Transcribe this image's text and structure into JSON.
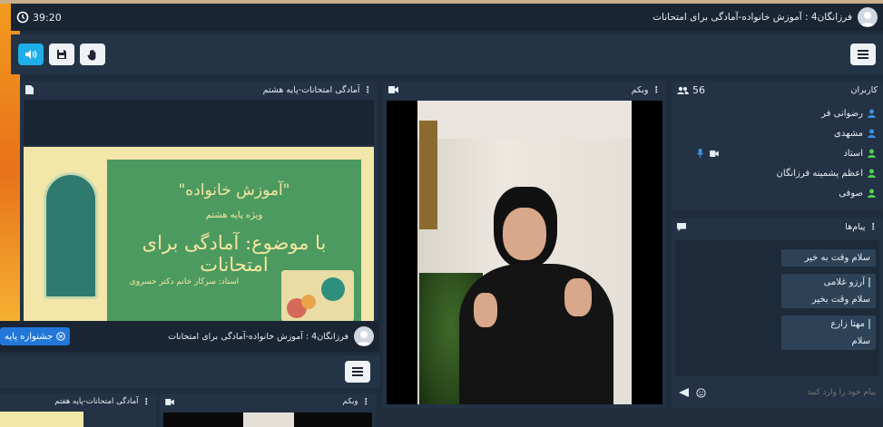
{
  "header": {
    "timer": "39:20",
    "title": "فرزانگان4 : آموزش خانواده-آمادگی برای امتحانات"
  },
  "toolbar": {
    "buttons": [
      "speaker-icon",
      "save-icon",
      "hand-icon"
    ],
    "menu": "menu-icon"
  },
  "presentation": {
    "title": "آمادگی امتحانات-پایه هشتم",
    "slide": {
      "line1": "\"آموزش خانواده\"",
      "line2": "ویژه پایه هشتم",
      "line3": "با موضوع: آمادگی برای امتحانات",
      "line4": "استاد: سرکار خانم دکتر خسروی"
    }
  },
  "webcam": {
    "title": "وبکم"
  },
  "users": {
    "title": "کاربران",
    "count": "56",
    "list": [
      {
        "name": "رضوانی فر",
        "color": "#3b8fe0"
      },
      {
        "name": "مشهدی",
        "color": "#3b8fe0"
      },
      {
        "name": "استاد",
        "color": "#4cd34c"
      },
      {
        "name": "اعظم پشمینه فرزانگان",
        "color": "#4cd34c"
      },
      {
        "name": "صوفی",
        "color": "#4cd34c"
      }
    ]
  },
  "messages": {
    "title": "پیام‌ها",
    "items": [
      {
        "sender": "",
        "text": "سلام وقت به خیر"
      },
      {
        "sender": "آرزو غلامی",
        "text": "سلام وقت بخیر"
      },
      {
        "sender": "مهتا زارع",
        "text": "سلام"
      }
    ],
    "placeholder": "پیام خود را وارد کنید"
  },
  "overlay": {
    "title": "فرزانگان4 : آموزش خانواده-آمادگی برای امتحانات",
    "notif": "جشنواره پایه",
    "presentation_title": "آمادگی امتحانات-پایه هفتم",
    "webcam_title": "وبکم"
  }
}
